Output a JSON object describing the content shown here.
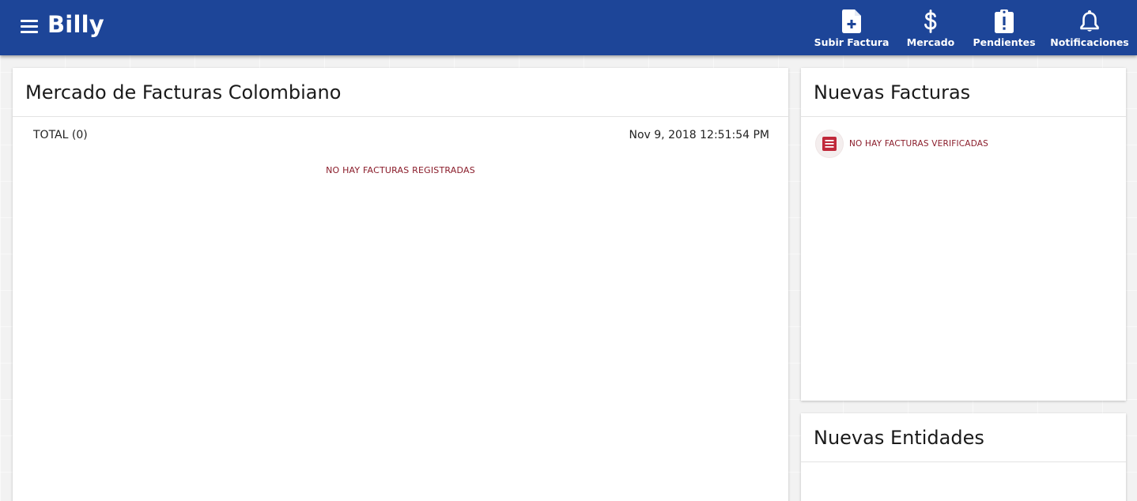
{
  "header": {
    "brand": "Billy",
    "nav": [
      {
        "label": "Subir Factura",
        "icon": "upload-document-icon"
      },
      {
        "label": "Mercado",
        "icon": "dollar-icon"
      },
      {
        "label": "Pendientes",
        "icon": "pending-clipboard-icon"
      },
      {
        "label": "Notificaciones",
        "icon": "bell-icon"
      }
    ]
  },
  "main": {
    "title": "Mercado de Facturas Colombiano",
    "total": "TOTAL (0)",
    "timestamp": "Nov 9, 2018 12:51:54 PM",
    "empty_message": "NO HAY FACTURAS REGISTRADAS"
  },
  "side": {
    "new_invoices": {
      "title": "Nuevas Facturas",
      "empty_message": "NO HAY FACTURAS VERIFICADAS",
      "icon": "invoice-document-icon"
    },
    "new_entities": {
      "title": "Nuevas Entidades"
    }
  },
  "colors": {
    "header_bg": "#1d4598",
    "accent_red": "#8a1c2a",
    "icon_red": "#c0283a"
  }
}
